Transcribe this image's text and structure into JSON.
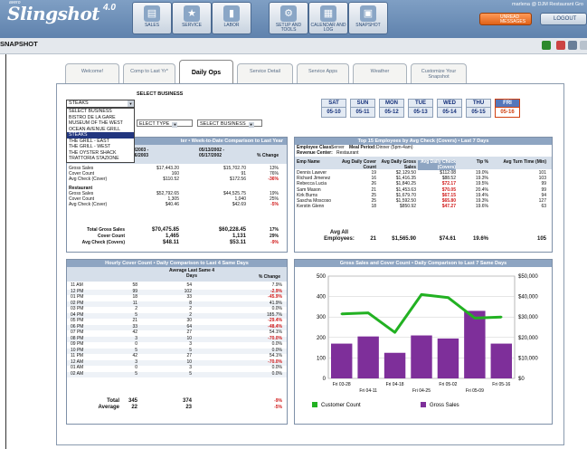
{
  "app": {
    "brand": "avero",
    "name": "Slingshot",
    "version": "4.0",
    "user": "marlena @ DJM Restaurant Gro",
    "messages_label": "UNREAD MESSAGES",
    "logout_label": "LOGOUT",
    "section": "SNAPSHOT"
  },
  "nav": [
    {
      "label": "SALES",
      "icon": "sales-icon"
    },
    {
      "label": "SERVICE",
      "icon": "star-icon"
    },
    {
      "label": "LABOR",
      "icon": "labor-icon"
    },
    {
      "label": "SETUP AND TOOLS",
      "icon": "tools-icon"
    },
    {
      "label": "CALENDAR AND LOG",
      "icon": "calendar-icon"
    },
    {
      "label": "SNAPSHOT",
      "icon": "snapshot-icon"
    }
  ],
  "tabs": [
    {
      "label": "Welcome!"
    },
    {
      "label": "Comp to Last Yr*"
    },
    {
      "label": "Daily Ops"
    },
    {
      "label": "Service Detail"
    },
    {
      "label": "Service Apps"
    },
    {
      "label": "Weather"
    },
    {
      "label": "Customize Your Snapshot"
    }
  ],
  "business": {
    "title": "SELECT BUSINESS",
    "selected": "STEAKS",
    "options": [
      "SELECT BUSINESS",
      "BISTRO DE LA GARE",
      "MUSEUM OF THE WEST",
      "OCEAN AVENUE GRILL",
      "STEAKS",
      "THE GRILL - EAST",
      "THE GRILL - WEST",
      "THE OYSTER SHACK",
      "TRATTORIA STAZIONE"
    ],
    "type_text": "ELECT TYPE",
    "select2_text": "SELECT BUSINESS"
  },
  "days": [
    {
      "name": "SAT",
      "date": "05-10"
    },
    {
      "name": "SUN",
      "date": "05-11"
    },
    {
      "name": "MON",
      "date": "05-12"
    },
    {
      "name": "TUE",
      "date": "05-13"
    },
    {
      "name": "WED",
      "date": "05-14"
    },
    {
      "name": "THU",
      "date": "05-15"
    },
    {
      "name": "FRI",
      "date": "05-16",
      "today": true
    }
  ],
  "wtd": {
    "title_frag": "ter • Week-to-Date Comparison to Last Year",
    "col1a": "2/2003 -",
    "col1b": "16/2003",
    "col2a": "05/13/2002 -",
    "col2b": "05/17/2002",
    "col3": "% Change",
    "sections": [
      {
        "name": "",
        "rows": [
          {
            "label": "Gross Sales",
            "v1": "$17,443.20",
            "v2": "$15,702.70",
            "pct": "13%"
          },
          {
            "label": "Cover Count",
            "v1": "160",
            "v2": "91",
            "pct": "76%"
          },
          {
            "label": "Avg Check (Cover)",
            "v1": "$110.52",
            "v2": "$172.56",
            "pct": "-36%",
            "neg": true
          }
        ]
      },
      {
        "name": "Restaurant",
        "rows": [
          {
            "label": "Gross Sales",
            "v1": "$52,792.65",
            "v2": "$44,525.75",
            "pct": "19%"
          },
          {
            "label": "Cover Count",
            "v1": "1,305",
            "v2": "1,040",
            "pct": "25%"
          },
          {
            "label": "Avg Check (Cover)",
            "v1": "$40.46",
            "v2": "$42.69",
            "pct": "-5%",
            "neg": true
          }
        ]
      }
    ],
    "totals": [
      {
        "label": "Total Gross Sales",
        "v1": "$70,475.85",
        "v2": "$60,228.45",
        "pct": "17%"
      },
      {
        "label": "Cover Count",
        "v1": "1,465",
        "v2": "1,131",
        "pct": "29%"
      },
      {
        "label": "Avg Check (Covers)",
        "v1": "$48.11",
        "v2": "$53.11",
        "pct": "-9%",
        "neg": true
      }
    ]
  },
  "employees": {
    "title": "Top 15 Employees by Avg Check (Covers) • Last 7 Days",
    "employee_class_label": "Employee Class:",
    "employee_class": "Server",
    "meal_period_label": "Meal Period:",
    "meal_period": "Dinner (5pm-4am)",
    "revenue_center_label": "Revenue Center:",
    "revenue_center": "Restaurant",
    "headers": [
      "Emp Name",
      "Avg Daily Cover Count",
      "Avg Daily Gross Sales",
      "Avg Daily Check (Covers)",
      "Tip %",
      "Avg Turn Time (Min)"
    ],
    "rows": [
      {
        "name": "Dennis Lawver",
        "cc": "19",
        "gs": "$2,129.50",
        "chk": "$112.08",
        "tip": "19.0%",
        "turn": "101",
        "hi": false
      },
      {
        "name": "Richard Jimenez",
        "cc": "16",
        "gs": "$1,416.35",
        "chk": "$88.52",
        "tip": "19.3%",
        "turn": "103",
        "hi": false
      },
      {
        "name": "Rebecca Lucia",
        "cc": "26",
        "gs": "$1,840.25",
        "chk": "$72.17",
        "tip": "19.5%",
        "turn": "99",
        "hi": true
      },
      {
        "name": "Sam Mason",
        "cc": "21",
        "gs": "$1,453.63",
        "chk": "$70.05",
        "tip": "20.4%",
        "turn": "99",
        "hi": true
      },
      {
        "name": "Kirk Burns",
        "cc": "25",
        "gs": "$1,679.70",
        "chk": "$67.15",
        "tip": "19.4%",
        "turn": "94",
        "hi": true
      },
      {
        "name": "Sascha Moscoso",
        "cc": "25",
        "gs": "$1,592.50",
        "chk": "$65.80",
        "tip": "19.3%",
        "turn": "127",
        "hi": true
      },
      {
        "name": "Kerstin Glenn",
        "cc": "18",
        "gs": "$850.92",
        "chk": "$47.27",
        "tip": "19.6%",
        "turn": "63",
        "hi": true
      }
    ],
    "avg_label": "Avg All Employees:",
    "avg": {
      "cc": "21",
      "gs": "$1,565.90",
      "chk": "$74.61",
      "tip": "19.6%",
      "turn": "105"
    }
  },
  "hourly": {
    "title": "Hourly Cover Count • Daily Comparison to Last 4 Same Days",
    "col_avg": "Average Last Same 4 Days",
    "col_pct": "% Change",
    "rows": [
      {
        "h": "11 AM",
        "c": "58",
        "a": "54",
        "p": "7.9%"
      },
      {
        "h": "12 PM",
        "c": "99",
        "a": "102",
        "p": "-2.9%",
        "neg": true
      },
      {
        "h": "01 PM",
        "c": "18",
        "a": "33",
        "p": "-45.9%",
        "neg": true
      },
      {
        "h": "02 PM",
        "c": "11",
        "a": "8",
        "p": "41.9%"
      },
      {
        "h": "03 PM",
        "c": "2",
        "a": "2",
        "p": "0.0%"
      },
      {
        "h": "04 PM",
        "c": "5",
        "a": "2",
        "p": "185.7%"
      },
      {
        "h": "05 PM",
        "c": "21",
        "a": "30",
        "p": "-29.4%",
        "neg": true
      },
      {
        "h": "06 PM",
        "c": "33",
        "a": "64",
        "p": "-48.4%",
        "neg": true
      },
      {
        "h": "07 PM",
        "c": "42",
        "a": "27",
        "p": "54.1%"
      },
      {
        "h": "08 PM",
        "c": "3",
        "a": "10",
        "p": "-70.0%",
        "neg": true
      },
      {
        "h": "09 PM",
        "c": "0",
        "a": "3",
        "p": "0.0%"
      },
      {
        "h": "10 PM",
        "c": "5",
        "a": "5",
        "p": "0.0%"
      },
      {
        "h": "11 PM",
        "c": "42",
        "a": "27",
        "p": "54.1%"
      },
      {
        "h": "12 AM",
        "c": "3",
        "a": "10",
        "p": "-70.0%",
        "neg": true
      },
      {
        "h": "01 AM",
        "c": "0",
        "a": "3",
        "p": "0.0%"
      },
      {
        "h": "02 AM",
        "c": "5",
        "a": "5",
        "p": "0.0%"
      }
    ],
    "total_label": "Total",
    "total": {
      "c": "345",
      "a": "374",
      "p": "-9%"
    },
    "average_label": "Average",
    "average": {
      "c": "22",
      "a": "23",
      "p": "-5%"
    }
  },
  "chart_data": {
    "type": "bar",
    "title": "Gross Sales and Cover Count • Daily Comparison to Last 7 Same Days",
    "categories": [
      "Fri 03-28",
      "Fri 04-11",
      "Fri 04-18",
      "Fri 04-25",
      "Fri 05-02",
      "Fri 05-09",
      "Fri 05-16"
    ],
    "x_ticks_top": [
      "Fri 03-28",
      "Fri 04-18",
      "Fri 05-02",
      "Fri 05-16"
    ],
    "x_ticks_bottom": [
      "Fri 04-11",
      "Fri 04-25",
      "Fri 05-09"
    ],
    "series": [
      {
        "name": "Gross Sales",
        "type": "bar",
        "axis": "right",
        "values": [
          17000,
          20500,
          12500,
          21000,
          19500,
          33000,
          17000
        ],
        "color": "#7e2f9a"
      },
      {
        "name": "Customer Count",
        "type": "line",
        "axis": "left",
        "values": [
          315,
          320,
          225,
          410,
          395,
          295,
          300
        ],
        "color": "#22b122"
      }
    ],
    "left_ylim": [
      0,
      500
    ],
    "left_ticks": [
      "0",
      "100",
      "200",
      "300",
      "400",
      "500"
    ],
    "right_ylim": [
      0,
      50000
    ],
    "right_ticks": [
      "$0",
      "$10,000",
      "$20,000",
      "$30,000",
      "$40,000",
      "$50,000"
    ],
    "grid": true,
    "legend": "bottom"
  }
}
